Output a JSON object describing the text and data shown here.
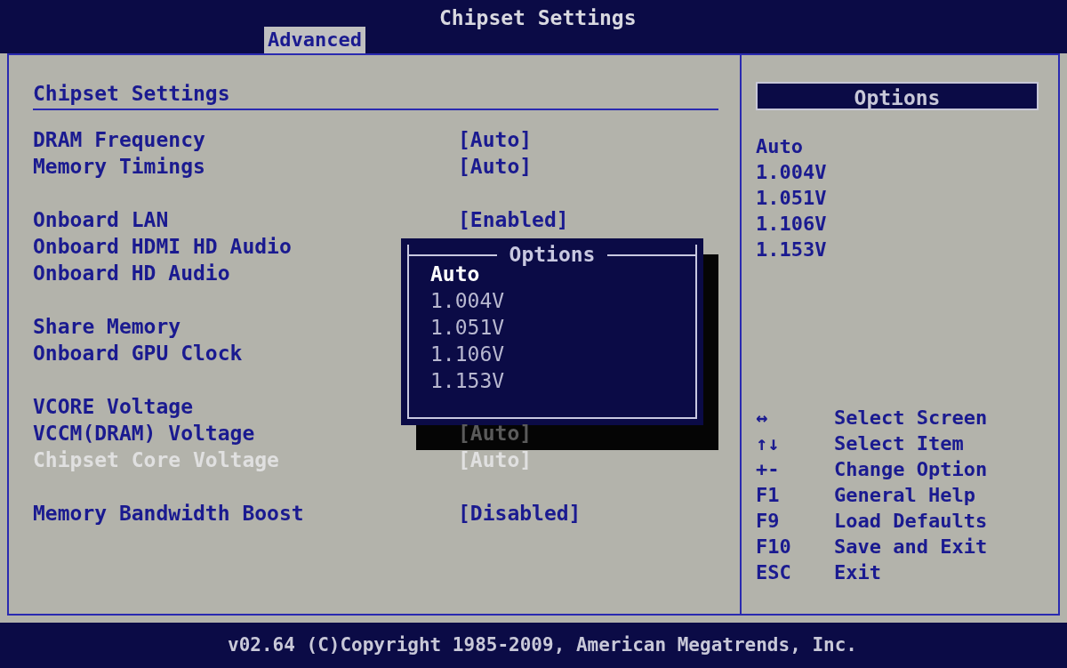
{
  "header": {
    "title": "Chipset Settings",
    "tabs": [
      {
        "label": "Advanced",
        "selected": true
      }
    ]
  },
  "main": {
    "title": "Chipset Settings",
    "groups": [
      {
        "items": [
          {
            "label": "DRAM Frequency",
            "value": "[Auto]",
            "selected": false
          },
          {
            "label": "Memory Timings",
            "value": "[Auto]",
            "selected": false
          }
        ]
      },
      {
        "items": [
          {
            "label": "Onboard LAN",
            "value": "[Enabled]",
            "selected": false
          },
          {
            "label": "Onboard HDMI HD Audio",
            "selected": false
          },
          {
            "label": "Onboard HD Audio",
            "selected": false
          }
        ]
      },
      {
        "items": [
          {
            "label": "Share Memory",
            "selected": false
          },
          {
            "label": "Onboard GPU Clock",
            "selected": false
          }
        ]
      },
      {
        "items": [
          {
            "label": "VCORE Voltage",
            "selected": false
          },
          {
            "label": "VCCM(DRAM) Voltage",
            "value": "[Auto]",
            "selected": false,
            "under_shadow": true
          },
          {
            "label": "Chipset Core Voltage",
            "value": "[Auto]",
            "selected": true
          }
        ]
      },
      {
        "items": [
          {
            "label": "Memory Bandwidth Boost",
            "value": "[Disabled]",
            "selected": false
          }
        ]
      }
    ]
  },
  "popup": {
    "title": "Options",
    "options": [
      {
        "label": "Auto",
        "selected": true
      },
      {
        "label": "1.004V",
        "selected": false
      },
      {
        "label": "1.051V",
        "selected": false
      },
      {
        "label": "1.106V",
        "selected": false
      },
      {
        "label": "1.153V",
        "selected": false
      }
    ]
  },
  "side": {
    "title": "Options",
    "options": [
      "Auto",
      "1.004V",
      "1.051V",
      "1.106V",
      "1.153V"
    ],
    "keys": [
      {
        "key": "↔",
        "action": "Select Screen"
      },
      {
        "key": "↑↓",
        "action": "Select Item"
      },
      {
        "key": "+-",
        "action": "Change Option"
      },
      {
        "key": "F1",
        "action": "General Help"
      },
      {
        "key": "F9",
        "action": "Load Defaults"
      },
      {
        "key": "F10",
        "action": "Save and Exit"
      },
      {
        "key": "ESC",
        "action": "Exit"
      }
    ]
  },
  "footer": {
    "copyright": "v02.64 (C)Copyright 1985-2009, American Megatrends, Inc."
  }
}
